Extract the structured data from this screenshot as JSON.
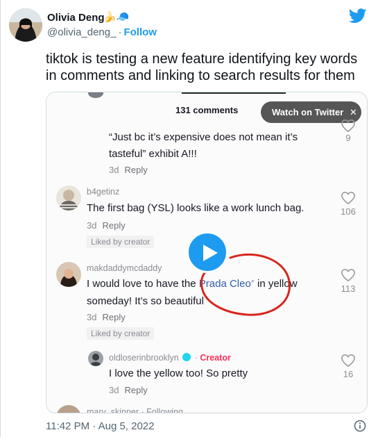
{
  "author": {
    "display_name": "Olivia Deng",
    "name_emoji": "🍌🧢",
    "handle": "@olivia_deng_",
    "separator": "·",
    "follow_label": "Follow"
  },
  "tweet": {
    "text": "tiktok is testing a new feature identifying key words in comments and linking to search results for them",
    "timestamp": "11:42 PM · Aug 5, 2022"
  },
  "video": {
    "comments_header": "131 comments",
    "watch_label": "Watch on Twitter",
    "close_symbol": "✕",
    "comments": [
      {
        "text_line1": "“Just bc it’s expensive does not mean it’s",
        "text_line2": "tasteful” exhibit A!!!",
        "time": "3d",
        "reply": "Reply",
        "likes": "9"
      },
      {
        "user": "b4getinz",
        "text_line1": "The first bag (YSL) looks like a work lunch bag.",
        "time": "3d",
        "reply": "Reply",
        "liked_badge": "Liked by creator",
        "likes": "106"
      },
      {
        "user": "makdaddymcdaddy",
        "text_before": "I would love to have the ",
        "link_word": "Prada Cleo",
        "search_glyph": "⌕",
        "text_after": " in yellow",
        "text_line2": "someday! It’s so beautiful",
        "time": "3d",
        "reply": "Reply",
        "liked_badge": "Liked by creator",
        "likes": "113"
      },
      {
        "user": "oldloserinbrooklyn",
        "creator_separator": "·",
        "creator_label": "Creator",
        "text_line1": "I love the yellow too! So pretty",
        "time": "3d",
        "reply": "Reply",
        "likes": "16"
      },
      {
        "user": "mary_skinner · Following"
      }
    ]
  },
  "colors": {
    "twitter_blue": "#1d9bf0",
    "tiktok_link": "#2f5ea8",
    "annotation_red": "#d7261e",
    "creator_red": "#fe2c55"
  },
  "icons": [
    "twitter-bird-icon",
    "play-icon",
    "heart-icon",
    "verified-icon",
    "info-icon",
    "close-icon",
    "search-glyph-icon"
  ]
}
